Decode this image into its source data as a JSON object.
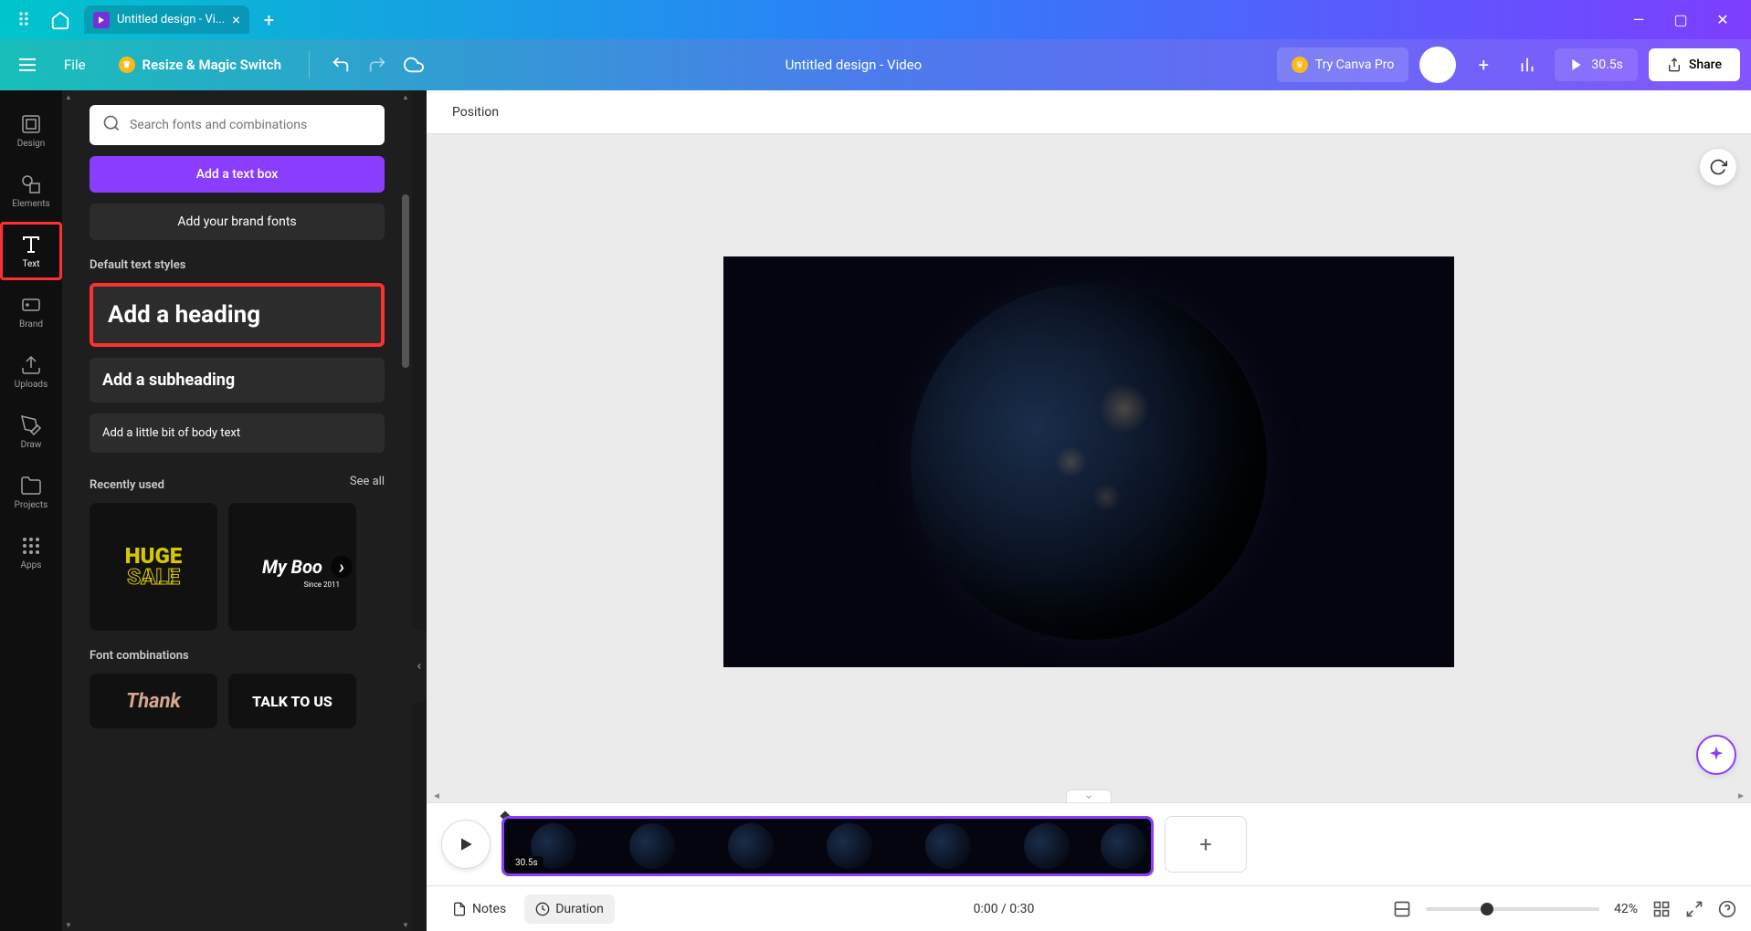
{
  "tab": {
    "title": "Untitled design - Vi..."
  },
  "menu": {
    "file": "File",
    "resize": "Resize & Magic Switch"
  },
  "header": {
    "title": "Untitled design - Video",
    "try_pro": "Try Canva Pro",
    "duration": "30.5s",
    "share": "Share"
  },
  "rail": {
    "design": "Design",
    "elements": "Elements",
    "text": "Text",
    "brand": "Brand",
    "uploads": "Uploads",
    "draw": "Draw",
    "projects": "Projects",
    "apps": "Apps"
  },
  "panel": {
    "search_placeholder": "Search fonts and combinations",
    "add_text_box": "Add a text box",
    "add_brand_fonts": "Add your brand fonts",
    "default_styles": "Default text styles",
    "add_heading": "Add a heading",
    "add_subheading": "Add a subheading",
    "add_body": "Add a little bit of body text",
    "recently_used": "Recently used",
    "see_all": "See all",
    "thumb_huge": "HUGE",
    "thumb_sale": "SALE",
    "thumb_mybook": "My Boo",
    "thumb_since": "Since 2011",
    "font_combinations": "Font combinations",
    "combo_thank": "Thank",
    "combo_talk": "TALK TO US"
  },
  "toolbar": {
    "position": "Position"
  },
  "timeline": {
    "clip_duration": "30.5s"
  },
  "bottom": {
    "notes": "Notes",
    "duration": "Duration",
    "time": "0:00 / 0:30",
    "zoom": "42%"
  }
}
